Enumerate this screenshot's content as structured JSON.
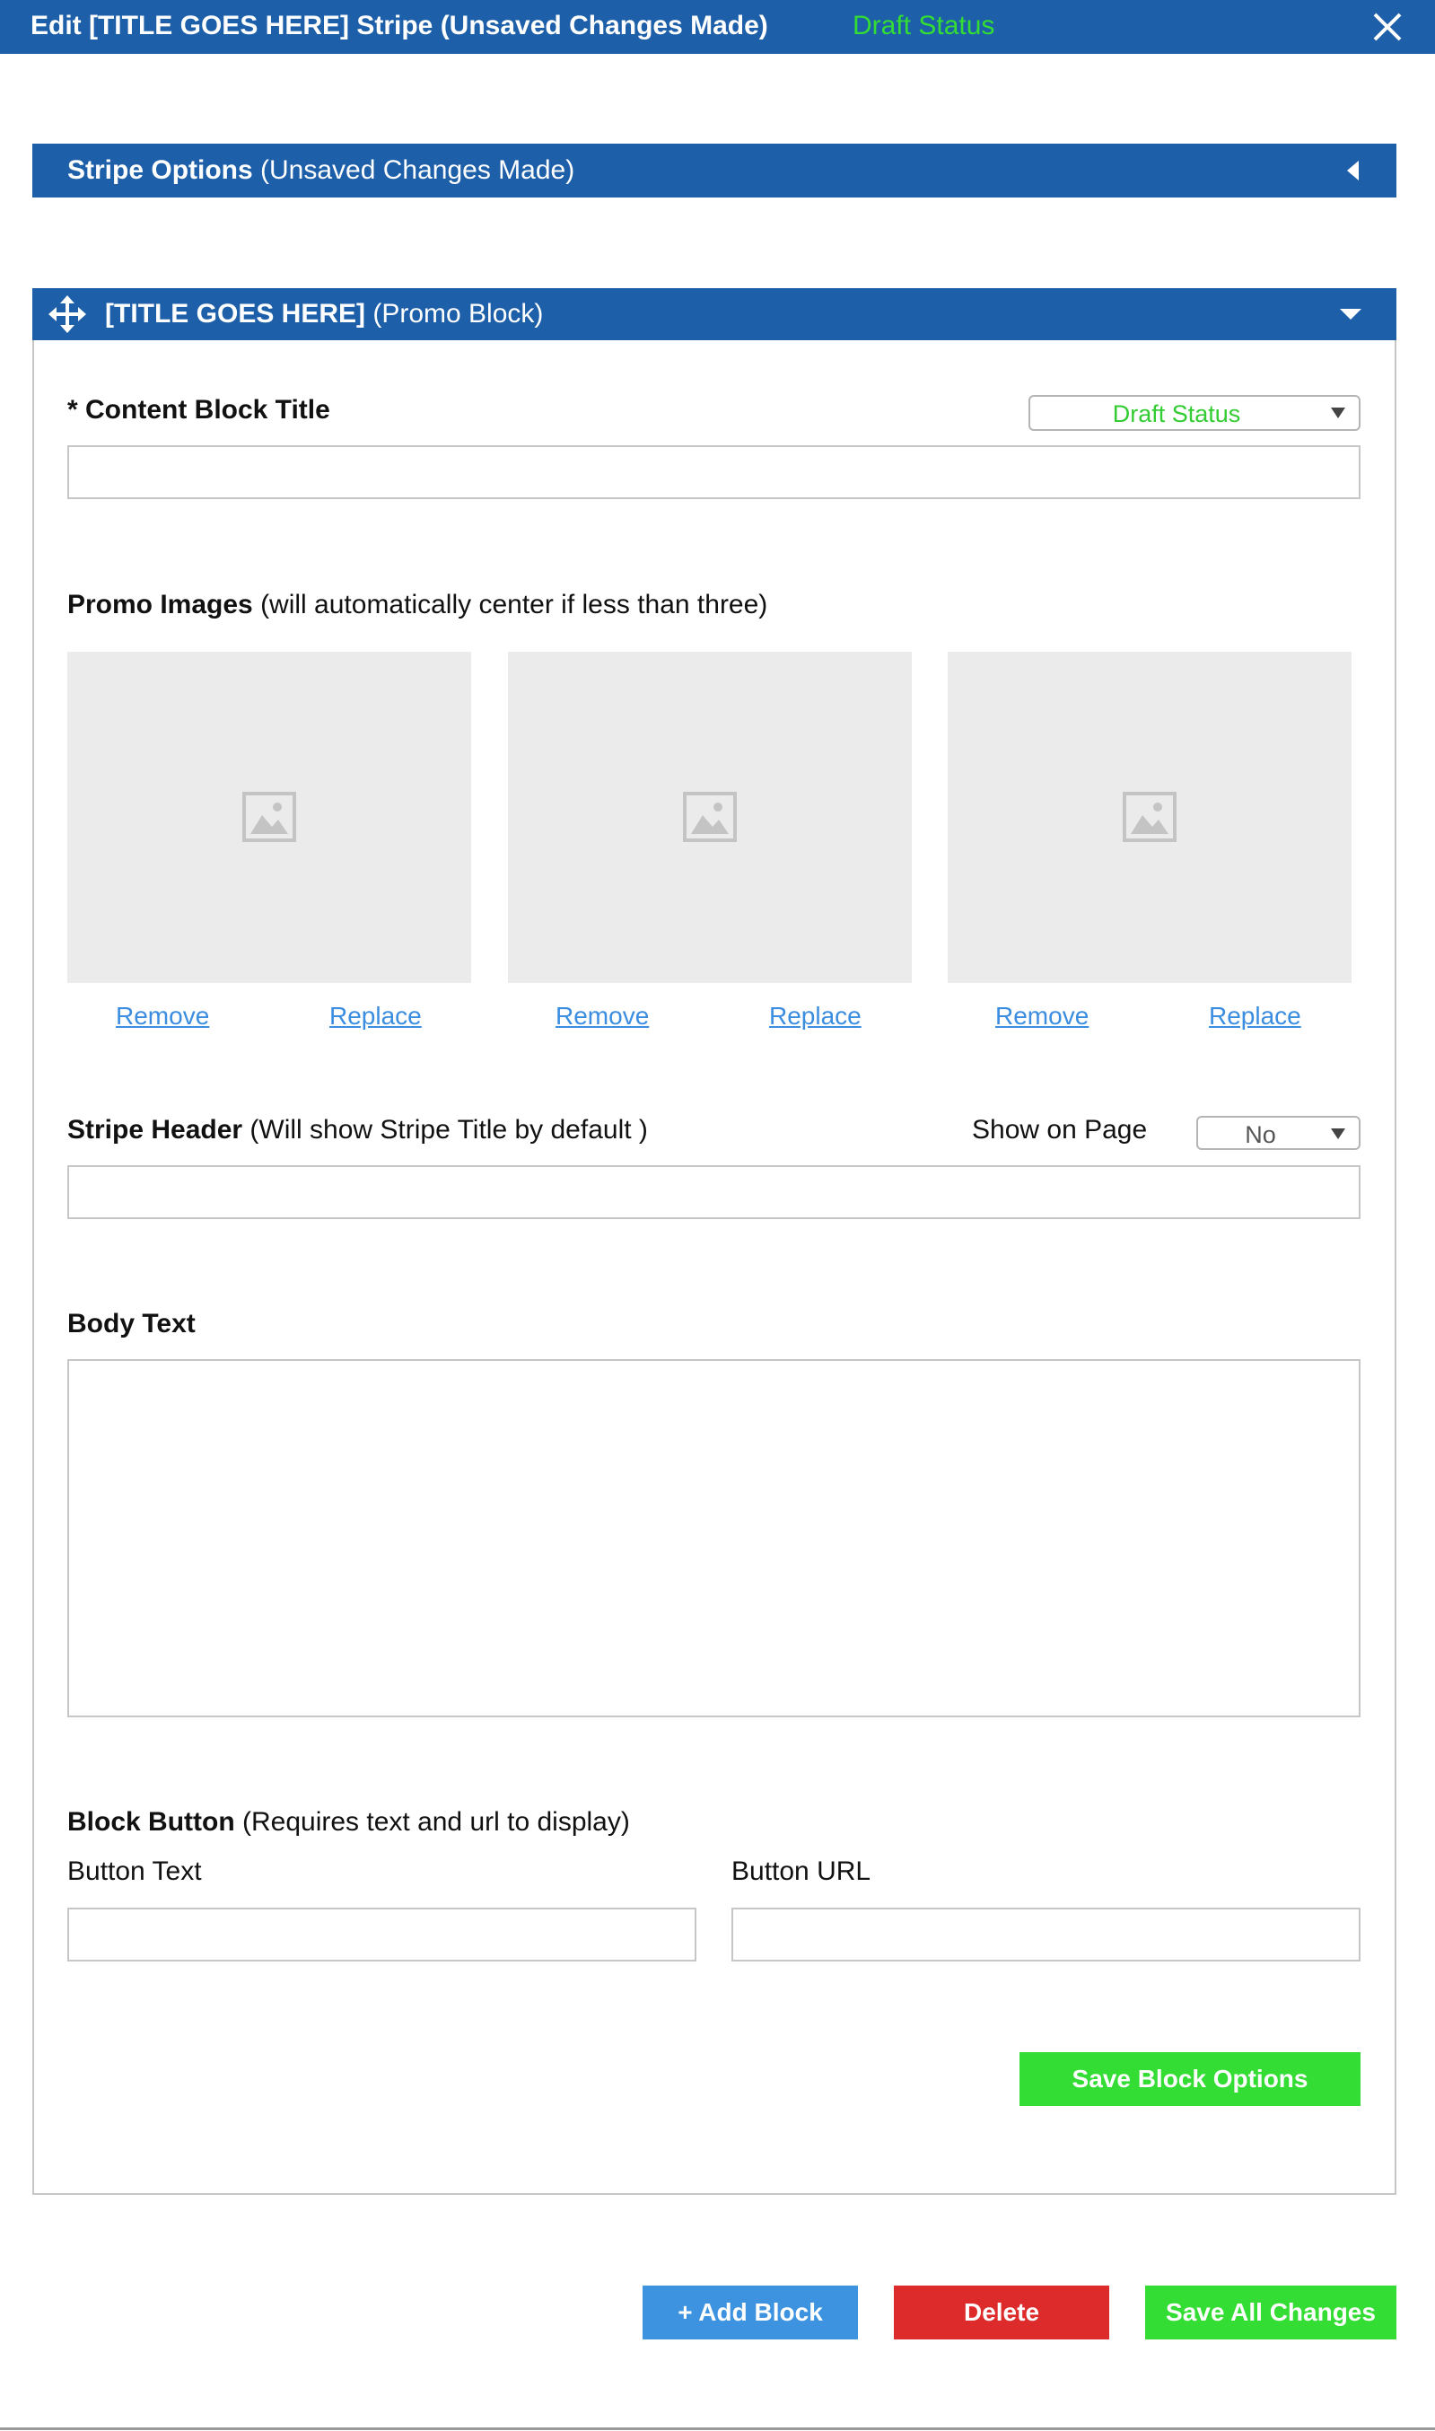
{
  "window": {
    "title": "Edit [TITLE GOES HERE] Stripe (Unsaved Changes Made)",
    "status": "Draft Status",
    "close_icon": "close-icon"
  },
  "stripe_options": {
    "title_bold": "Stripe Options",
    "title_note": " (Unsaved Changes Made)",
    "icon": "caret-left-icon"
  },
  "block": {
    "title_bold": "[TITLE GOES HERE]",
    "title_note": " (Promo Block)",
    "move_icon": "move-icon",
    "collapse_icon": "caret-down-icon",
    "content_title": {
      "label": "* Content Block Title",
      "value": "",
      "status_select": "Draft Status"
    },
    "promo_images": {
      "label_bold": "Promo Images",
      "label_note": " (will automatically center if less than three)",
      "items": [
        {
          "remove": "Remove",
          "replace": "Replace"
        },
        {
          "remove": "Remove",
          "replace": "Replace"
        },
        {
          "remove": "Remove",
          "replace": "Replace"
        }
      ]
    },
    "stripe_header": {
      "label_bold": "Stripe Header",
      "label_note": " (Will show Stripe Title by default )",
      "show_on_page_label": "Show on Page",
      "show_on_page_value": "No",
      "value": ""
    },
    "body_text": {
      "label": "Body Text",
      "value": ""
    },
    "block_button": {
      "label_bold": "Block Button",
      "label_note": " (Requires text and url to display)",
      "text_label": "Button Text",
      "url_label": "Button URL",
      "text_value": "",
      "url_value": ""
    },
    "save_label": "Save Block Options"
  },
  "footer": {
    "add_block": "+ Add Block",
    "delete": "Delete",
    "save_all": "Save All Changes"
  },
  "colors": {
    "header_blue": "#1d5fa8",
    "status_green": "#33dd33",
    "link_blue": "#3b8de0",
    "add_blue": "#3d93df",
    "delete_red": "#dd2a2a"
  }
}
